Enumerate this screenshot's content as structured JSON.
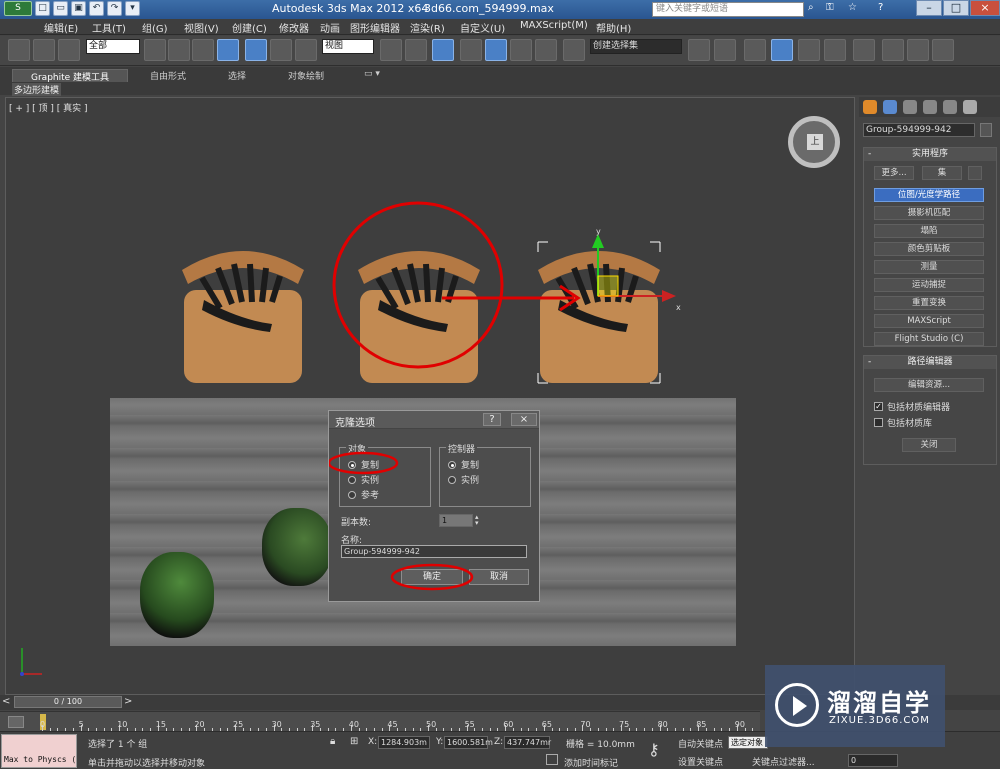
{
  "title_bar": {
    "app_title": "Autodesk 3ds Max  2012 x64",
    "file_name": "3d66.com_594999.max",
    "search_placeholder": "键入关键字或短语"
  },
  "menu": [
    "编辑(E)",
    "工具(T)",
    "组(G)",
    "视图(V)",
    "创建(C)",
    "修改器",
    "动画",
    "图形编辑器",
    "渲染(R)",
    "自定义(U)",
    "MAXScript(M)",
    "帮助(H)"
  ],
  "toolbar": {
    "selection_filter": "全部",
    "ref_coord": "视图",
    "named_selection": "创建选择集"
  },
  "ribbon": {
    "tabs": [
      "Graphite 建模工具",
      "自由形式",
      "选择",
      "对象绘制"
    ],
    "sub": "多边形建模"
  },
  "viewport": {
    "label": "[ + ] [ 顶 ] [ 真实 ]",
    "viewcube_face": "上",
    "axis_x": "x",
    "axis_y": "y"
  },
  "clone_dialog": {
    "title": "克隆选项",
    "help": "?",
    "close": "×",
    "object_group": "对象",
    "object_options": [
      "复制",
      "实例",
      "参考"
    ],
    "object_selected": 0,
    "controller_group": "控制器",
    "controller_options": [
      "复制",
      "实例"
    ],
    "controller_selected": 0,
    "copies_label": "副本数:",
    "copies_value": "1",
    "name_label": "名称:",
    "name_value": "Group-594999-942",
    "ok": "确定",
    "cancel": "取消"
  },
  "command_panel": {
    "object_name": "Group-594999-942",
    "utilities_header": "实用程序",
    "more_button": "更多...",
    "sets_button": "集",
    "utilities": [
      "位图/光度学路径",
      "摄影机匹配",
      "塌陷",
      "颜色剪贴板",
      "测量",
      "运动捕捉",
      "重置变换",
      "MAXScript",
      "Flight Studio (C)"
    ],
    "selected_utility": 0,
    "path_editor_header": "路径编辑器",
    "edit_resources": "编辑资源...",
    "include_material_editor": "包括材质编辑器",
    "include_material_library": "包括材质库",
    "include_material_editor_checked": true,
    "include_material_library_checked": false,
    "close_button": "关闭"
  },
  "timeline": {
    "slider": "0 / 100",
    "ticks": [
      "0",
      "5",
      "10",
      "15",
      "20",
      "25",
      "30",
      "35",
      "40",
      "45",
      "50",
      "55",
      "60",
      "65",
      "70",
      "75",
      "80",
      "85",
      "90"
    ]
  },
  "status": {
    "maxscript": "Max to Physcs (",
    "selected": "选择了 1 个 组",
    "prompt": "单击并拖动以选择并移动对象",
    "x_label": "X:",
    "x_value": "1284.903m",
    "y_label": "Y:",
    "y_value": "1600.581m",
    "z_label": "Z:",
    "z_value": "437.747mr",
    "grid": "栅格 = 10.0mm",
    "add_time_tag": "添加时间标记",
    "auto_key": "自动关键点",
    "set_key": "设置关键点",
    "selected_object": "选定对象",
    "key_filters": "关键点过滤器...",
    "frame": "0"
  },
  "watermark": {
    "title": "溜溜自学",
    "url": "ZIXUE.3D66.COM"
  },
  "colors": {
    "accent": "#3b6dc0",
    "highlight_red": "#e00000"
  }
}
